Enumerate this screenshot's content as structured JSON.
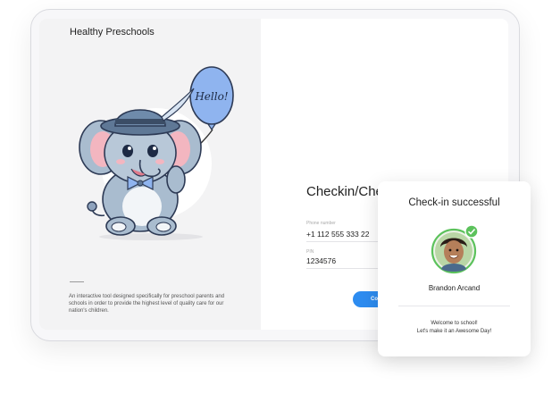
{
  "brand": {
    "name": "Healthy Preschools"
  },
  "illustration": {
    "balloon_text": "Hello!"
  },
  "left_panel": {
    "tagline": "An interactive tool designed specifically for preschool parents and schools in order to provide the highest level of quality care for our nation's children."
  },
  "form": {
    "title": "Checkin/Che",
    "phone_label": "Phone number",
    "phone_value": "+1 112 555 333 22",
    "pin_label": "PIN",
    "pin_value": "1234576",
    "submit_label": "Co"
  },
  "checkin_card": {
    "title": "Check-in successful",
    "name": "Brandon Arcand",
    "message_line1": "Welcome to school!",
    "message_line2": "Let's make it an Awesome Day!"
  },
  "colors": {
    "accent_blue": "#2d8cf0",
    "success_green": "#5cc25c",
    "balloon_blue": "#8fb4ef"
  }
}
